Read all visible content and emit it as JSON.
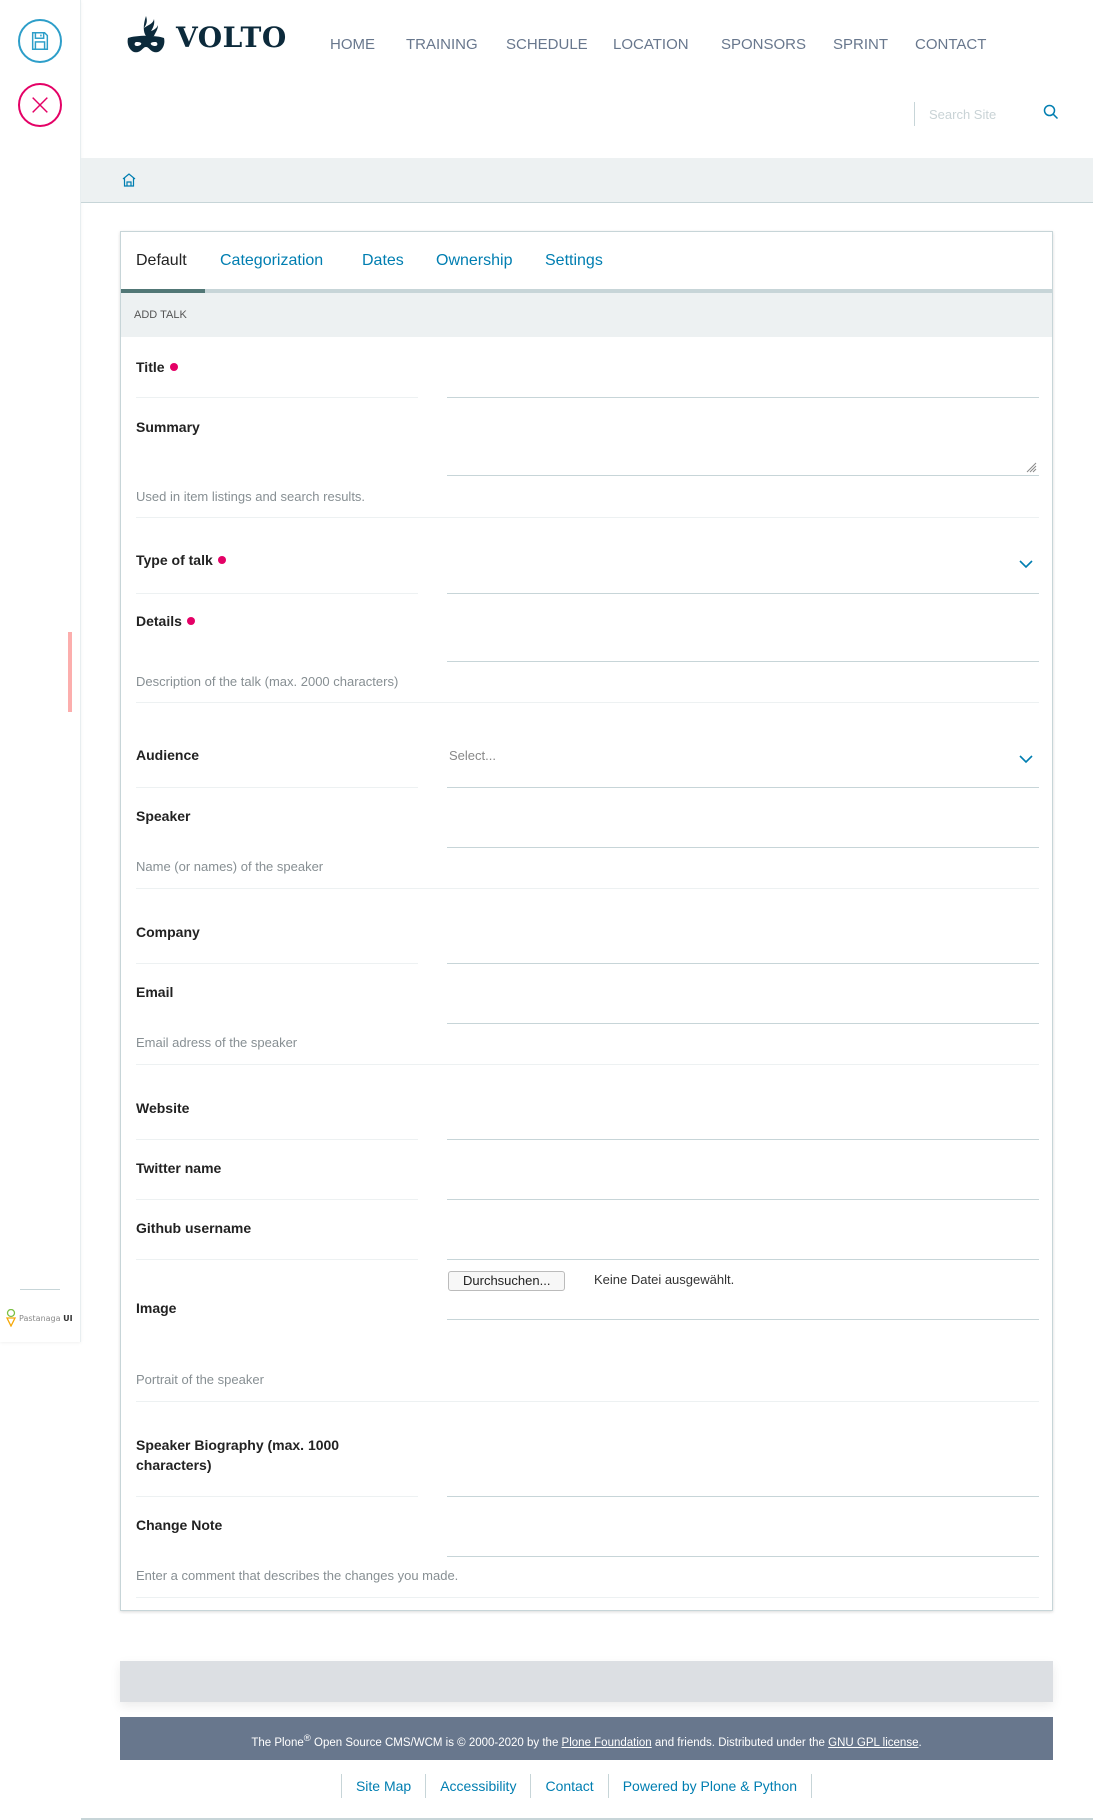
{
  "toolbar": {
    "save_icon": "save-icon",
    "cancel_icon": "close-icon",
    "brand_prefix": "Pastanaga",
    "brand_suffix": "UI"
  },
  "header": {
    "logo_text": "VOLTO",
    "nav": [
      "HOME",
      "TRAINING",
      "SCHEDULE",
      "LOCATION",
      "SPONSORS",
      "SPRINT",
      "CONTACT"
    ],
    "search_placeholder": "Search Site"
  },
  "form": {
    "tabs": [
      "Default",
      "Categorization",
      "Dates",
      "Ownership",
      "Settings"
    ],
    "active_tab": "Default",
    "section_title": "ADD TALK",
    "fields": {
      "title": {
        "label": "Title",
        "required": true
      },
      "summary": {
        "label": "Summary",
        "help": "Used in item listings and search results."
      },
      "type_of_talk": {
        "label": "Type of talk",
        "required": true
      },
      "details": {
        "label": "Details",
        "required": true,
        "help": "Description of the talk (max. 2000 characters)"
      },
      "audience": {
        "label": "Audience",
        "placeholder": "Select..."
      },
      "speaker": {
        "label": "Speaker",
        "help": "Name (or names) of the speaker"
      },
      "company": {
        "label": "Company"
      },
      "email": {
        "label": "Email",
        "help": "Email adress of the speaker"
      },
      "website": {
        "label": "Website"
      },
      "twitter": {
        "label": "Twitter name"
      },
      "github": {
        "label": "Github username"
      },
      "image": {
        "label": "Image",
        "button": "Durchsuchen...",
        "status": "Keine Datei ausgewählt.",
        "help": "Portrait of the speaker"
      },
      "speaker_bio": {
        "label_line1": "Speaker Biography (max. 1000",
        "label_line2": "characters)"
      },
      "change_note": {
        "label": "Change Note",
        "help": "Enter a comment that describes the changes you made."
      }
    }
  },
  "footer": {
    "text_1": "The Plone",
    "reg": "®",
    "text_2": " Open Source CMS/WCM is © 2000-2020 by the ",
    "link_foundation": "Plone Foundation",
    "text_3": " and friends. Distributed under the ",
    "link_license": "GNU GPL license",
    "text_4": ".",
    "links": [
      "Site Map",
      "Accessibility",
      "Contact",
      "Powered by Plone & Python"
    ]
  },
  "colors": {
    "accent": "#007eb1",
    "required": "#e40166",
    "save": "#2d9ec9",
    "footer": "#68778d"
  }
}
